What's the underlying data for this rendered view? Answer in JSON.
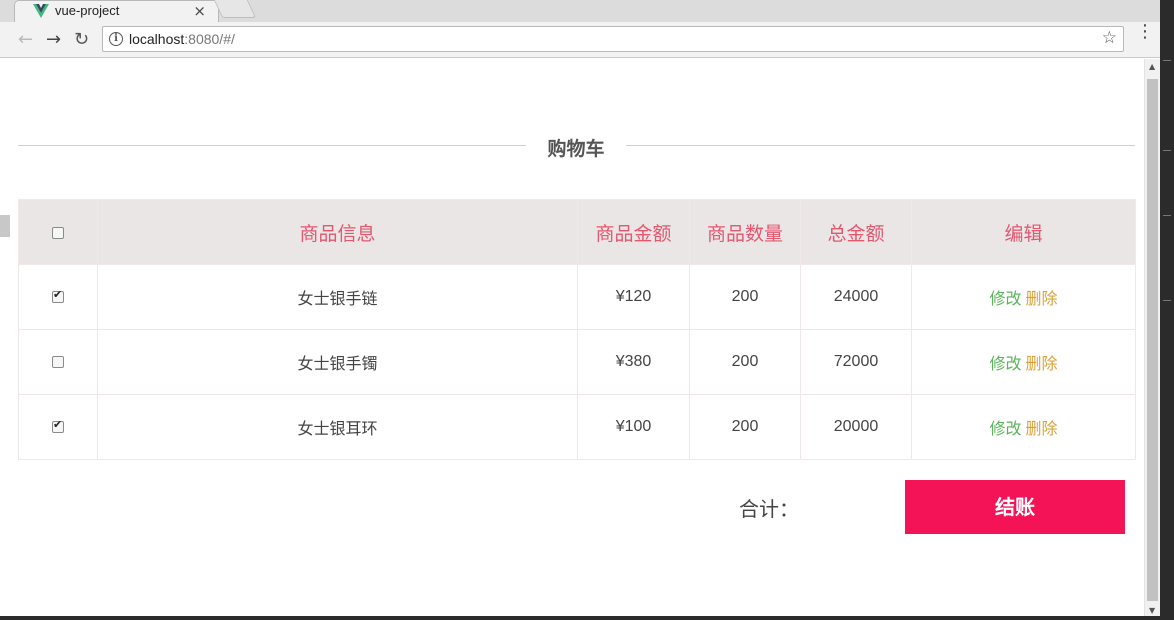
{
  "browser": {
    "tab_title": "vue-project",
    "tab_close": "×",
    "url_host": "localhost",
    "url_rest": ":8080/#/",
    "nav_back": "←",
    "nav_forward": "→",
    "nav_reload": "↻",
    "info_icon": "i",
    "star_icon": "☆",
    "menu_icon": "⋮",
    "scroll_up": "▲",
    "scroll_down": "▼"
  },
  "page": {
    "title": "购物车",
    "columns": [
      "商品信息",
      "商品金额",
      "商品数量",
      "总金额",
      "编辑"
    ],
    "rows": [
      {
        "checked": true,
        "name": "女士银手链",
        "price": "¥120",
        "qty": "200",
        "total": "24000",
        "edit": "修改",
        "delete": "删除"
      },
      {
        "checked": false,
        "name": "女士银手镯",
        "price": "¥380",
        "qty": "200",
        "total": "72000",
        "edit": "修改",
        "delete": "删除"
      },
      {
        "checked": true,
        "name": "女士银耳环",
        "price": "¥100",
        "qty": "200",
        "total": "20000",
        "edit": "修改",
        "delete": "删除"
      }
    ],
    "total_label": "合计：",
    "checkout_label": "结账"
  },
  "colors": {
    "header_bg": "#ebe6e6",
    "header_text": "#e3576f",
    "edit_link": "#5ab55a",
    "delete_link": "#d9a238",
    "checkout_bg": "#f41356"
  }
}
